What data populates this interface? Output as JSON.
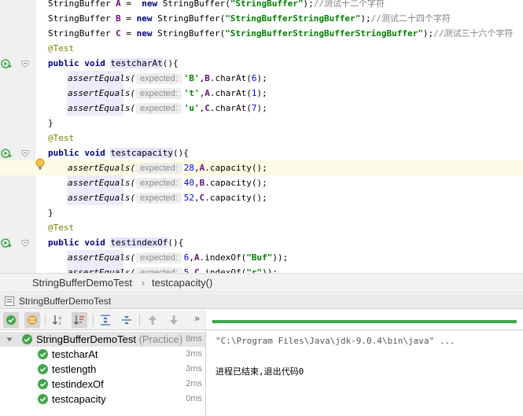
{
  "editor": {
    "declarations": [
      {
        "type": "StringBuffer",
        "name": "A",
        "op": " =  ",
        "kw": "new",
        "ctor": "StringBuffer",
        "arg": "\"StringBuffer\"",
        "comment": "//测试十二个字符"
      },
      {
        "type": "StringBuffer",
        "name": "B",
        "op": " = ",
        "kw": "new",
        "ctor": "StringBuffer",
        "arg": "\"StringBufferStringBuffer\"",
        "comment": "//测试二十四个字符"
      },
      {
        "type": "StringBuffer",
        "name": "C",
        "op": " = ",
        "kw": "new",
        "ctor": "StringBuffer",
        "arg": "\"StringBufferStringBufferStringBuffer\"",
        "comment": "//测试三十六个字符"
      }
    ],
    "annotation": "@Test",
    "modifier": "public",
    "return_type": "void",
    "method_suffix": "(){",
    "closing_brace": "}",
    "assert_name": "assertEquals",
    "hint_label": "expected:",
    "methods": [
      {
        "name": "testcharAt",
        "asserts": [
          {
            "expected": "'B'",
            "target": "B",
            "call": "charAt",
            "arg": "6",
            "end": ");"
          },
          {
            "expected": "'t'",
            "target": "A",
            "call": "charAt",
            "arg": "1",
            "end": ");"
          },
          {
            "expected": "'u'",
            "target": "C",
            "call": "charAt",
            "arg": "7",
            "end": ");"
          }
        ]
      },
      {
        "name": "testcapacity",
        "asserts": [
          {
            "expected": "28",
            "target": "A",
            "call": "capacity",
            "arg": "",
            "end": ");"
          },
          {
            "expected": "40",
            "target": "B",
            "call": "capacity",
            "arg": "",
            "end": ");"
          },
          {
            "expected": "52",
            "target": "C",
            "call": "capacity",
            "arg": "",
            "end": ");"
          }
        ]
      },
      {
        "name": "testindexOf",
        "asserts": [
          {
            "expected": "6",
            "target": "A",
            "call": "indexOf",
            "arg": "\"Buf\"",
            "end": "));"
          },
          {
            "expected": "5",
            "target": "C",
            "call": "indexOf",
            "arg": "\"r\"",
            "end": "));"
          }
        ]
      }
    ]
  },
  "breadcrumb": {
    "class_name": "StringBufferDemoTest",
    "separator": "›",
    "method_name": "testcapacity()"
  },
  "run_panel": {
    "title": "StringBufferDemoTest",
    "more_label": "»",
    "progress_fraction": 1.0,
    "root": {
      "name": "StringBufferDemoTest",
      "suffix": "(Practice)",
      "time": "8ms"
    },
    "tests": [
      {
        "name": "testcharAt",
        "time": "3ms"
      },
      {
        "name": "testlength",
        "time": "3ms"
      },
      {
        "name": "testindexOf",
        "time": "2ms"
      },
      {
        "name": "testcapacity",
        "time": "0ms"
      }
    ],
    "console": {
      "command": "\"C:\\Program Files\\Java\\jdk-9.0.4\\bin\\java\" ...",
      "exit_message": "进程已结束,退出代码0"
    }
  },
  "colors": {
    "keyword": "#000080",
    "string": "#008000",
    "comment": "#808080",
    "annotation": "#808000",
    "field": "#660e7a",
    "number": "#0000ff",
    "pass": "#3fa648"
  },
  "icons": {
    "run_gutter": "run-test-icon",
    "fold": "fold-icon",
    "bulb": "lightbulb-icon",
    "pass": "check-circle-icon"
  }
}
